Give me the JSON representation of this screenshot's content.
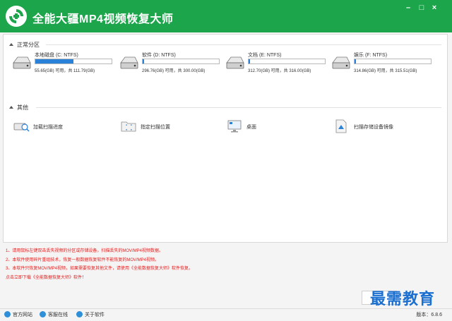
{
  "app": {
    "title": "全能大疆MP4视频恢复大师",
    "logo_icon": "recover-arrows-icon"
  },
  "window_controls": {
    "minimize": "–",
    "maximize": "□",
    "close": "×"
  },
  "partitions_section": {
    "title": "正常分区"
  },
  "drives": [
    {
      "name": "本地磁盘 (C: NTFS)",
      "info": "55.65(GB) 可用，共 111.79(GB)",
      "used_fraction": 0.5
    },
    {
      "name": "软件 (D: NTFS)",
      "info": "296.76(GB) 可用，共 300.00(GB)",
      "used_fraction": 0.01
    },
    {
      "name": "文档 (E: NTFS)",
      "info": "312.70(GB) 可用，共 316.00(GB)",
      "used_fraction": 0.01
    },
    {
      "name": "娱乐 (F: NTFS)",
      "info": "314.86(GB) 可用，共 315.51(GB)",
      "used_fraction": 0.01
    }
  ],
  "other_section": {
    "title": "其他"
  },
  "tools": [
    {
      "label": "加载扫描进度",
      "icon": "load-progress-icon"
    },
    {
      "label": "指定扫描位置",
      "icon": "scan-location-icon"
    },
    {
      "label": "桌面",
      "icon": "desktop-icon"
    },
    {
      "label": "扫描存储设备镜像",
      "icon": "device-image-icon"
    }
  ],
  "notes": [
    "1、请用鼠标左键双击丢失视频的分区或存储设备，扫描丢失的MOV/MP4视频数据。",
    "2、本软件使用碎片重组技术，恢复一般数据恢复软件不能恢复的MOV/MP4视频。",
    "3、本软件只恢复MOV/MP4视频，如果需要恢复其他文件，请使用《全能数据恢复大师》软件恢复。",
    "    点击立即下载《全能数据恢复大师》软件！"
  ],
  "footer": {
    "links": [
      {
        "label": "官方网站",
        "icon": "home-icon"
      },
      {
        "label": "客服在线",
        "icon": "chat-icon"
      },
      {
        "label": "关于软件",
        "icon": "info-icon"
      }
    ],
    "version": "版本：6.8.6"
  },
  "watermark": {
    "text": "最需教育"
  },
  "colors": {
    "accent": "#1da54c",
    "drive_fill": "#2a82d8",
    "note_text": "#e02020"
  }
}
